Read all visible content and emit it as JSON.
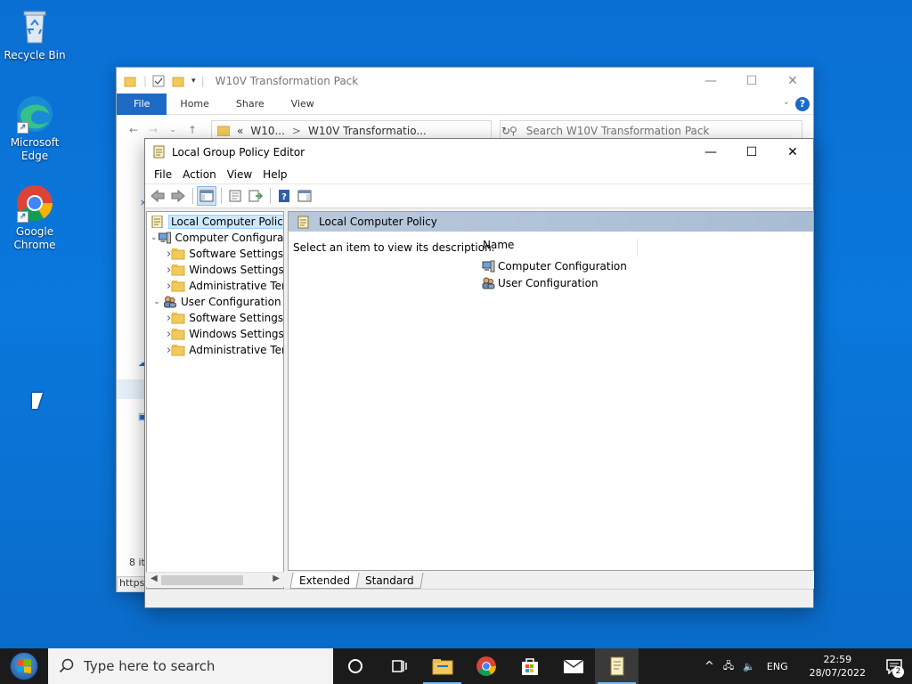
{
  "desktop": {
    "icons": [
      {
        "label": "Recycle Bin"
      },
      {
        "label": "Microsoft Edge"
      },
      {
        "label": "Google Chrome"
      }
    ]
  },
  "explorer": {
    "title": "W10V Transformation Pack",
    "ribbon_tabs": [
      "File",
      "Home",
      "Share",
      "View"
    ],
    "path": [
      "«",
      "W10...",
      ">",
      "W10V Transformatio..."
    ],
    "search_placeholder": "Search W10V Transformation Pack",
    "status_text": "8 it",
    "url_tip": "https:"
  },
  "gpedit": {
    "title": "Local Group Policy Editor",
    "menu": [
      "File",
      "Action",
      "View",
      "Help"
    ],
    "tree": [
      {
        "label": "Local Computer Policy",
        "indent": 0,
        "expander": "",
        "icon": "policy-icon",
        "selected": true
      },
      {
        "label": "Computer Configuration",
        "indent": 1,
        "expander": "v",
        "icon": "computer-icon"
      },
      {
        "label": "Software Settings",
        "indent": 2,
        "expander": ">",
        "icon": "folder-icon"
      },
      {
        "label": "Windows Settings",
        "indent": 2,
        "expander": ">",
        "icon": "folder-icon"
      },
      {
        "label": "Administrative Templates",
        "indent": 2,
        "expander": ">",
        "icon": "folder-icon"
      },
      {
        "label": "User Configuration",
        "indent": 1,
        "expander": "v",
        "icon": "users-icon"
      },
      {
        "label": "Software Settings",
        "indent": 2,
        "expander": ">",
        "icon": "folder-icon"
      },
      {
        "label": "Windows Settings",
        "indent": 2,
        "expander": ">",
        "icon": "folder-icon"
      },
      {
        "label": "Administrative Templates",
        "indent": 2,
        "expander": ">",
        "icon": "folder-icon"
      }
    ],
    "content_header": "Local Computer Policy",
    "description": "Select an item to view its description.",
    "column_name": "Name",
    "items": [
      {
        "label": "Computer Configuration",
        "icon": "computer-icon"
      },
      {
        "label": "User Configuration",
        "icon": "users-icon"
      }
    ],
    "tabs": [
      "Extended",
      "Standard"
    ]
  },
  "taskbar": {
    "search_placeholder": "Type here to search",
    "language": "ENG",
    "time": "22:59",
    "date": "28/07/2022",
    "notification_count": "2"
  },
  "colors": {
    "accent": "#1c6ac4",
    "desktop": "#0a78dd",
    "taskbar": "#1b1b1b"
  }
}
